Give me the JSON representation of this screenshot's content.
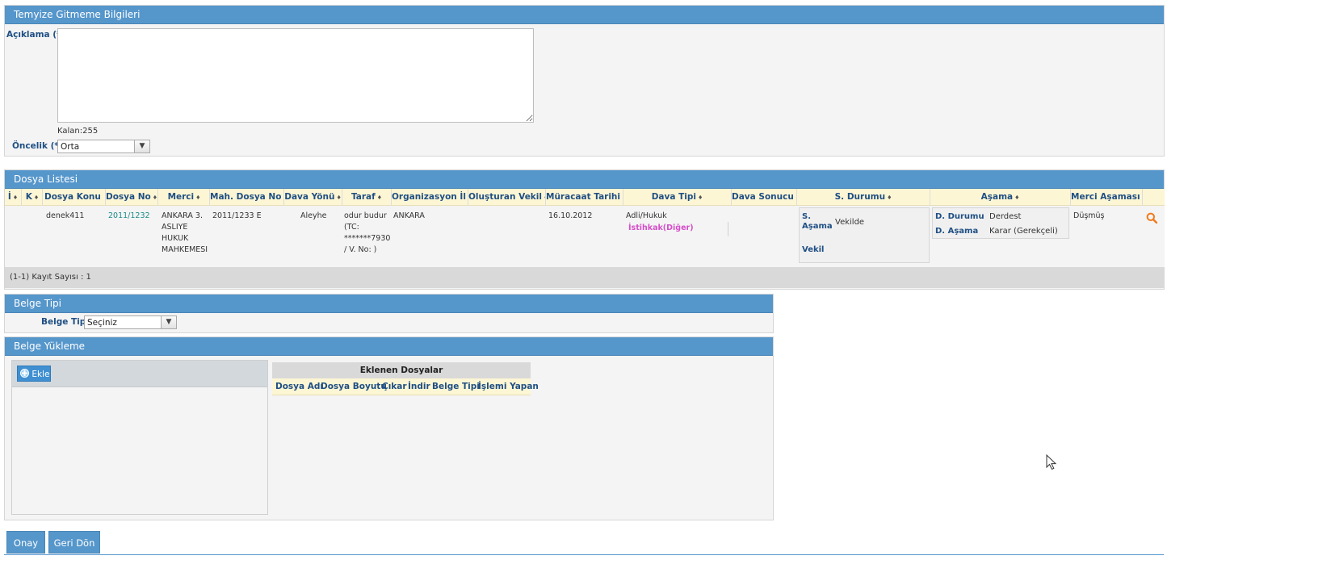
{
  "temyiz": {
    "title": "Temyize Gitmeme Bilgileri",
    "aciklama_label": "Açıklama (*)",
    "aciklama_value": "",
    "kalan": "Kalan:255",
    "oncelik_label": "Öncelik (*)",
    "oncelik_value": "Orta"
  },
  "dosya": {
    "title": "Dosya Listesi",
    "columns": [
      "İ",
      "K",
      "Dosya Konu",
      "Dosya No",
      "Merci",
      "Mah. Dosya No",
      "Dava Yönü",
      "Taraf",
      "Organizasyon İl",
      "Oluşturan Vekil",
      "Müracaat Tarihi",
      "Dava Tipi",
      "Dava Sonucu",
      "S. Durumu",
      "Aşama",
      "Merci Aşaması"
    ],
    "sort_glyph": "♦",
    "row": {
      "konu": "denek411",
      "no": "2011/1232",
      "merci": [
        "ANKARA 3.",
        "ASLIYE",
        "HUKUK",
        "MAHKEMESI"
      ],
      "mah_no": "2011/1233 E",
      "yon": "Aleyhe",
      "taraf": [
        "odur budur",
        "(TC:",
        "*******7930",
        "/ V. No: )"
      ],
      "il": "ANKARA",
      "vekil": "",
      "tarih": "16.10.2012",
      "tip": "Adli/Hukuk",
      "tip_alt": "İstihkak(Diğer)",
      "sonuc": "",
      "s_asama_label": [
        "S.",
        "Aşama"
      ],
      "s_asama_value": "Vekilde",
      "vekil_label": "Vekil",
      "d_durumu_label": "D. Durumu",
      "d_durumu_value": "Derdest",
      "d_asama_label": "D. Aşama",
      "d_asama_value": "Karar (Gerekçeli)",
      "merci_asamasi": "Düşmüş"
    },
    "footer": "(1-1) Kayıt Sayısı : 1"
  },
  "belge_tipi": {
    "title": "Belge Tipi",
    "label": "Belge Tipi",
    "value": "Seçiniz"
  },
  "belge_yukleme": {
    "title": "Belge Yükleme",
    "add_label": "Ekle",
    "eklenen_title": "Eklenen Dosyalar",
    "columns": [
      "Dosya Adı",
      "Dosya Boyutu",
      "Çıkar",
      "İndir",
      "Belge Tipi",
      "İşlemi Yapan"
    ]
  },
  "actions": {
    "onay": "Onay",
    "geri": "Geri Dön"
  },
  "colors": {
    "header_blue": "#5596cb",
    "label_blue": "#1f4f84",
    "link_teal": "#1b8a8a",
    "pink": "#d44fc8",
    "search_orange": "#f07a1a"
  }
}
